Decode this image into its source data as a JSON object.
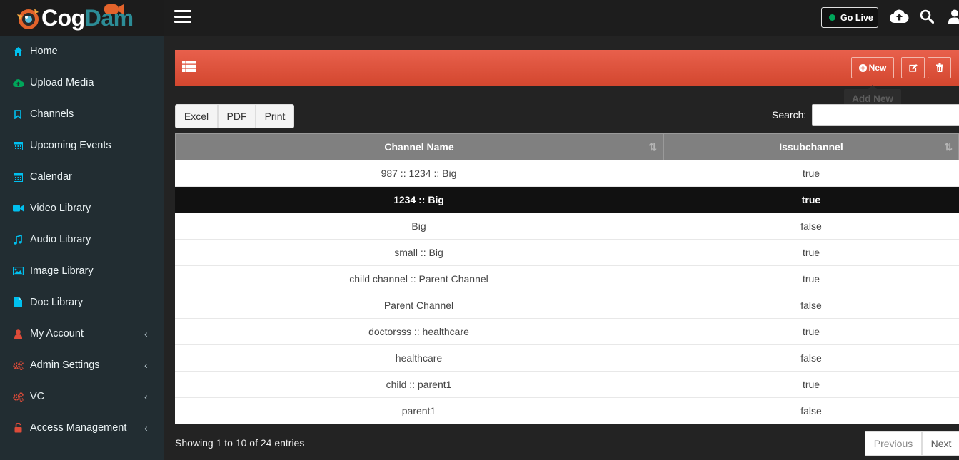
{
  "logo": {
    "part1": "Cog",
    "part2": "Dam"
  },
  "sidebar": {
    "items": [
      {
        "label": "Home",
        "icon": "home-icon"
      },
      {
        "label": "Upload Media",
        "icon": "cloud-upload-icon"
      },
      {
        "label": "Channels",
        "icon": "bookmark-icon"
      },
      {
        "label": "Upcoming Events",
        "icon": "calendar-icon"
      },
      {
        "label": "Calendar",
        "icon": "calendar-icon"
      },
      {
        "label": "Video Library",
        "icon": "video-camera-icon"
      },
      {
        "label": "Audio Library",
        "icon": "music-note-icon"
      },
      {
        "label": "Image Library",
        "icon": "image-icon"
      },
      {
        "label": "Doc Library",
        "icon": "document-icon"
      },
      {
        "label": "My Account",
        "icon": "user-icon",
        "chevron": "‹"
      },
      {
        "label": "Admin Settings",
        "icon": "gears-icon",
        "chevron": "‹"
      },
      {
        "label": "VC",
        "icon": "gears-icon",
        "chevron": "‹"
      },
      {
        "label": "Access Management",
        "icon": "unlock-icon",
        "chevron": "‹"
      }
    ]
  },
  "topbar": {
    "go_live": "Go Live"
  },
  "toolbar": {
    "new_label": "New",
    "tooltip": "Add New"
  },
  "exports": [
    "Excel",
    "PDF",
    "Print"
  ],
  "search": {
    "label": "Search:",
    "value": "",
    "placeholder": ""
  },
  "table": {
    "columns": [
      "Channel Name",
      "Issubchannel"
    ],
    "sort_glyph": "⇅",
    "rows": [
      [
        "987 :: 1234 :: Big",
        "true"
      ],
      [
        "1234 :: Big",
        "true"
      ],
      [
        "Big",
        "false"
      ],
      [
        "small :: Big",
        "true"
      ],
      [
        "child channel :: Parent Channel",
        "true"
      ],
      [
        "Parent Channel",
        "false"
      ],
      [
        "doctorsss :: healthcare",
        "true"
      ],
      [
        "healthcare",
        "false"
      ],
      [
        "child :: parent1",
        "true"
      ],
      [
        "parent1",
        "false"
      ]
    ],
    "selected_row_index": 1
  },
  "footer": {
    "info": "Showing 1 to 10 of 24 entries",
    "previous": "Previous",
    "next": "Next"
  },
  "colors": {
    "accent_red": "#dd4b39",
    "sidebar_bg": "#222d32",
    "icon_teal": "#00c0ef",
    "icon_green": "#00a65a",
    "icon_red": "#dd4b39"
  }
}
